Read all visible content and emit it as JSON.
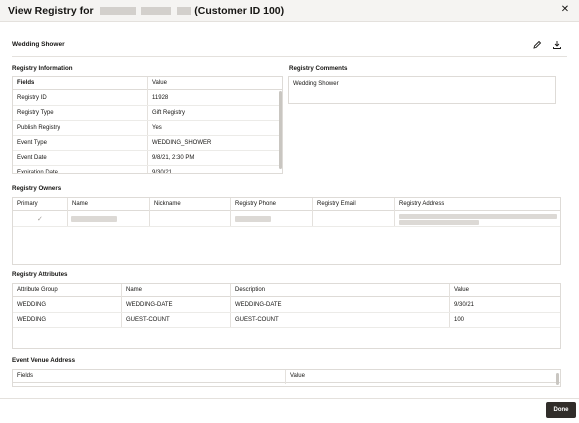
{
  "dialog": {
    "title_prefix": "View Registry for",
    "title_suffix": "(Customer ID 100)",
    "close_glyph": "✕"
  },
  "registry": {
    "name": "Wedding Shower"
  },
  "registry_information": {
    "label": "Registry Information",
    "headers": [
      "Fields",
      "Value"
    ],
    "rows": [
      [
        "Registry ID",
        "11928"
      ],
      [
        "Registry Type",
        "Gift Registry"
      ],
      [
        "Publish Registry",
        "Yes"
      ],
      [
        "Event Type",
        "WEDDING_SHOWER"
      ],
      [
        "Event Date",
        "9/8/21, 2:30 PM"
      ],
      [
        "Expiration Date",
        "9/30/21"
      ]
    ]
  },
  "registry_comments": {
    "label": "Registry Comments",
    "text": "Wedding Shower"
  },
  "registry_owners": {
    "label": "Registry Owners",
    "headers": [
      "Primary",
      "Name",
      "Nickname",
      "Registry Phone",
      "Registry Email",
      "Registry Address"
    ],
    "check_glyph": "✓"
  },
  "registry_attributes": {
    "label": "Registry Attributes",
    "headers": [
      "Attribute Group",
      "Name",
      "Description",
      "Value"
    ],
    "rows": [
      [
        "WEDDING",
        "WEDDING-DATE",
        "WEDDING-DATE",
        "9/30/21"
      ],
      [
        "WEDDING",
        "GUEST-COUNT",
        "GUEST-COUNT",
        "100"
      ]
    ]
  },
  "event_venue": {
    "label": "Event Venue Address",
    "headers": [
      "Fields",
      "Value"
    ]
  },
  "footer": {
    "done_label": "Done"
  },
  "colors": {
    "primary_button": "#312d2a",
    "title_bar": "#f5f4f2"
  }
}
